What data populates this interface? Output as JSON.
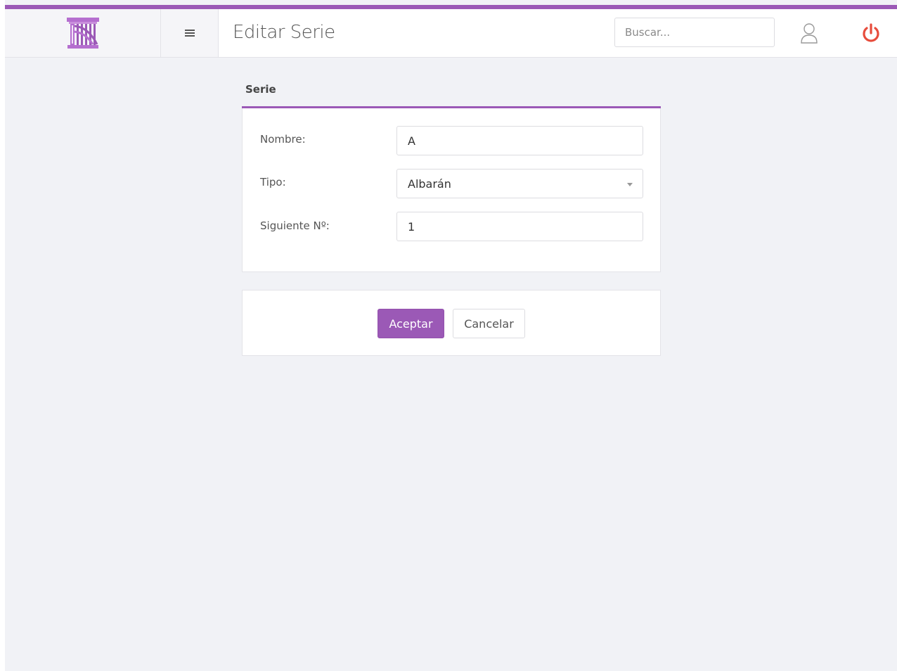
{
  "header": {
    "logo_icon": "columns-logo-icon",
    "menu_icon": "hamburger-icon",
    "title": "Editar Serie",
    "search_placeholder": "Buscar...",
    "user_icon": "user-icon",
    "power_icon": "power-icon"
  },
  "colors": {
    "accent": "#9b59b6",
    "power": "#e74c3c",
    "background": "#f1f2f6"
  },
  "panel": {
    "title": "Serie",
    "fields": {
      "nombre_label": "Nombre:",
      "nombre_value": "A",
      "tipo_label": "Tipo:",
      "tipo_value": "Albarán",
      "siguiente_label": "Siguiente Nº:",
      "siguiente_value": "1"
    }
  },
  "actions": {
    "accept_label": "Aceptar",
    "cancel_label": "Cancelar"
  }
}
